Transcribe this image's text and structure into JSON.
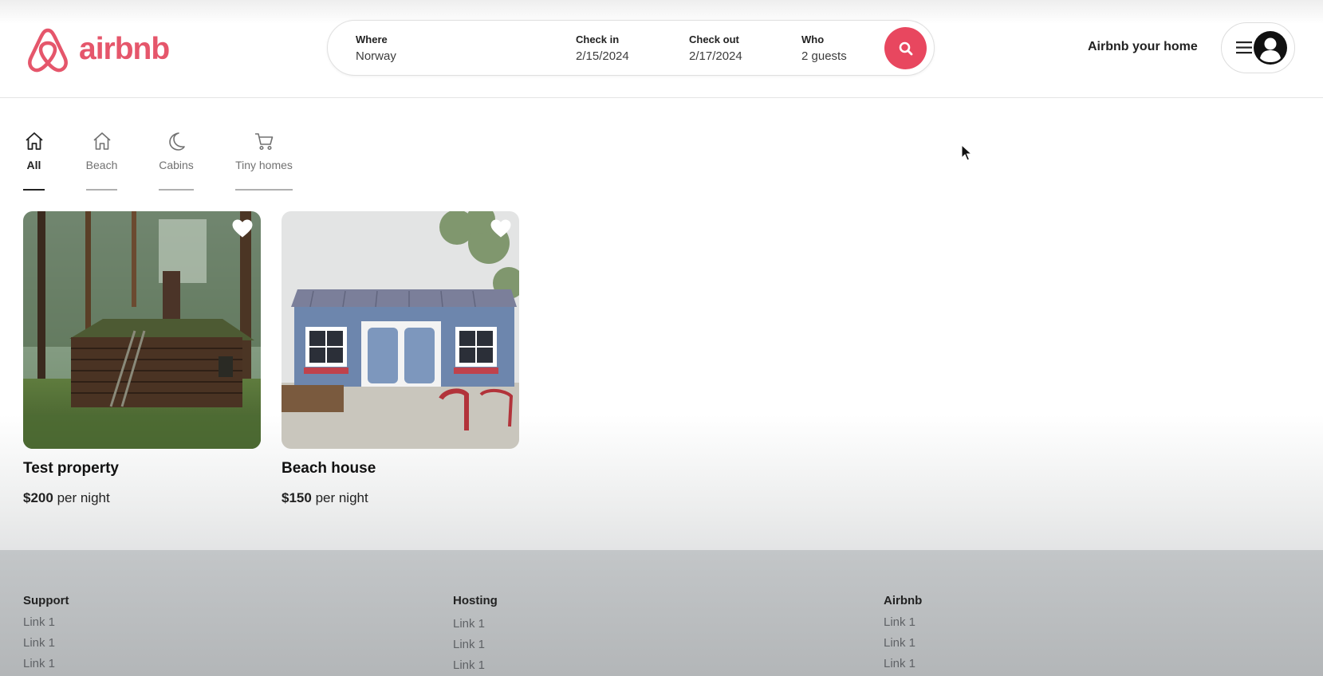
{
  "brand": {
    "name": "airbnb",
    "color": "#E5566B"
  },
  "search": {
    "where_label": "Where",
    "where_value": "Norway",
    "checkin_label": "Check in",
    "checkin_value": "2/15/2024",
    "checkout_label": "Check out",
    "checkout_value": "2/17/2024",
    "who_label": "Who",
    "who_value": "2 guests",
    "button_color": "#E8475F"
  },
  "header": {
    "host_link": "Airbnb your home",
    "menu_icon": "hamburger-icon",
    "avatar_icon": "user-avatar-icon"
  },
  "categories": [
    {
      "label": "All",
      "icon": "home-icon",
      "active": true
    },
    {
      "label": "Beach",
      "icon": "home-icon",
      "active": false
    },
    {
      "label": "Cabins",
      "icon": "moon-icon",
      "active": false
    },
    {
      "label": "Tiny homes",
      "icon": "cart-icon",
      "active": false
    }
  ],
  "listings": [
    {
      "title": "Test property",
      "price": "$200",
      "price_suffix": "per night",
      "photo": "log-cabin-in-forest"
    },
    {
      "title": "Beach house",
      "price": "$150",
      "price_suffix": "per night",
      "photo": "blue-tiny-house"
    }
  ],
  "footer": {
    "columns": [
      {
        "heading": "Support",
        "links": [
          "Link 1",
          "Link 1",
          "Link 1"
        ]
      },
      {
        "heading": "Hosting",
        "links": [
          "Link 1",
          "Link 1",
          "Link 1"
        ]
      },
      {
        "heading": "Airbnb",
        "links": [
          "Link 1",
          "Link 1",
          "Link 1"
        ]
      }
    ]
  }
}
